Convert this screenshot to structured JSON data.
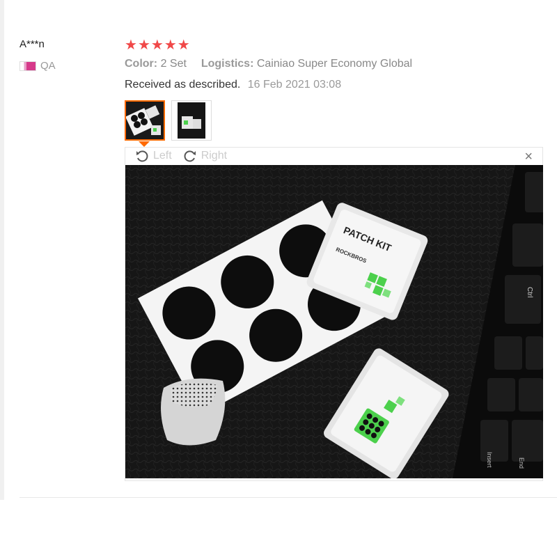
{
  "review": {
    "user": "A***n",
    "country": "QA",
    "rating": 5,
    "stars": [
      "★",
      "★",
      "★",
      "★",
      "★"
    ],
    "color_label": "Color:",
    "color_value": "2 Set",
    "logistics_label": "Logistics:",
    "logistics_value": "Cainiao Super Economy Global",
    "text": "Received as described.",
    "date": "16 Feb 2021 03:08"
  },
  "viewer": {
    "rotate_left_label": "Left",
    "rotate_right_label": "Right",
    "close_symbol": "×",
    "product_box_title": "PATCH KIT",
    "brand": "ROCKBROS"
  },
  "colors": {
    "star": "#f04848",
    "selected_thumb_border": "#ff6a00",
    "muted_text": "#999999"
  },
  "icons": {
    "rotate_left": "rotate-left-icon",
    "rotate_right": "rotate-right-icon",
    "close": "close-icon"
  }
}
